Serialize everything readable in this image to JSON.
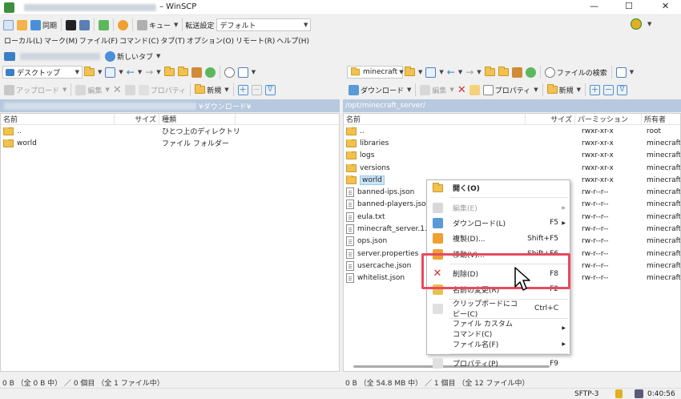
{
  "window": {
    "title": "– WinSCP",
    "minimize": "—",
    "maximize": "☐",
    "close": "✕"
  },
  "toolbar1": {
    "sync_label": "同期",
    "queue_label": "キュー",
    "transfer_settings_label": "転送設定",
    "transfer_preset": "デフォルト"
  },
  "menubar": [
    "ローカル(L)",
    "マーク(M)",
    "ファイル(F)",
    "コマンド(C)",
    "タブ(T)",
    "オプション(O)",
    "リモート(R)",
    "ヘルプ(H)"
  ],
  "sessionbar": {
    "new_tab_label": "新しいタブ"
  },
  "left": {
    "drive_label": "デスクトップ",
    "upload_label": "アップロード",
    "edit_label": "編集",
    "properties_label": "プロパティ",
    "new_label": "新規",
    "path": "¥ダウンロード¥",
    "columns": {
      "name": "名前",
      "size": "サイズ",
      "type": "種類"
    },
    "files": [
      {
        "name": "..",
        "size": "",
        "type": "ひとつ上のディレクトリ",
        "icon": "up-folder"
      },
      {
        "name": "world",
        "size": "",
        "type": "ファイル フォルダー",
        "icon": "folder"
      }
    ],
    "status": "0 B （全 0 B 中） ／ 0 個目 （全 1 ファイル中）"
  },
  "right": {
    "drive_label": "minecraft",
    "download_label": "ダウンロード",
    "edit_label": "編集",
    "properties_label": "プロパティ",
    "new_label": "新規",
    "search_label": "ファイルの検索",
    "path": "/opt/minecraft_server/",
    "columns": {
      "name": "名前",
      "size": "サイズ",
      "permissions": "パーミッション",
      "owner": "所有者"
    },
    "files": [
      {
        "name": "..",
        "perm": "rwxr-xr-x",
        "owner": "root",
        "icon": "up-folder"
      },
      {
        "name": "libraries",
        "perm": "rwxr-xr-x",
        "owner": "minecraft",
        "icon": "folder"
      },
      {
        "name": "logs",
        "perm": "rwxr-xr-x",
        "owner": "minecraft",
        "icon": "folder"
      },
      {
        "name": "versions",
        "perm": "rwxr-xr-x",
        "owner": "minecraft",
        "icon": "folder"
      },
      {
        "name": "world",
        "perm": "rwxr-xr-x",
        "owner": "minecraft",
        "icon": "folder"
      },
      {
        "name": "banned-ips.json",
        "perm": "rw-r--r--",
        "owner": "minecraft",
        "icon": "file"
      },
      {
        "name": "banned-players.json",
        "perm": "rw-r--r--",
        "owner": "minecraft",
        "icon": "file"
      },
      {
        "name": "eula.txt",
        "perm": "rw-r--r--",
        "owner": "minecraft",
        "icon": "file"
      },
      {
        "name": "minecraft_server.1.21",
        "perm": "rw-r--r--",
        "owner": "minecraft",
        "icon": "file"
      },
      {
        "name": "ops.json",
        "perm": "rw-r--r--",
        "owner": "minecraft",
        "icon": "file"
      },
      {
        "name": "server.properties",
        "perm": "rw-r--r--",
        "owner": "minecraft",
        "icon": "file"
      },
      {
        "name": "usercache.json",
        "perm": "rw-r--r--",
        "owner": "minecraft",
        "icon": "file"
      },
      {
        "name": "whitelist.json",
        "perm": "rw-r--r--",
        "owner": "minecraft",
        "icon": "file"
      }
    ],
    "status": "0 B （全 54.8 MB 中） ／ 1 個目 （全 12 ファイル中）"
  },
  "context_menu": [
    {
      "label": "開く(O)",
      "shortcut": "",
      "bold": true,
      "disabled": false,
      "sub": false
    },
    {
      "label": "編集(E)",
      "shortcut": "",
      "disabled": true,
      "sub": true
    },
    {
      "label": "ダウンロード(L)",
      "shortcut": "F5",
      "disabled": false,
      "sub": true
    },
    {
      "label": "複製(D)...",
      "shortcut": "Shift+F5",
      "disabled": false,
      "sub": false
    },
    {
      "label": "移動(V)...",
      "shortcut": "Shift+F6",
      "disabled": false,
      "sub": false
    },
    {
      "label": "削除(D)",
      "shortcut": "F8",
      "disabled": false,
      "sub": false
    },
    {
      "label": "名前の変更(R)",
      "shortcut": "F2",
      "disabled": false,
      "sub": false
    },
    {
      "label": "クリップボードにコピー(C)",
      "shortcut": "Ctrl+C",
      "disabled": false,
      "sub": false
    },
    {
      "label": "ファイル カスタム コマンド(C)",
      "shortcut": "",
      "disabled": false,
      "sub": true
    },
    {
      "label": "ファイル名(F)",
      "shortcut": "",
      "disabled": false,
      "sub": true
    },
    {
      "label": "プロパティ(P)",
      "shortcut": "F9",
      "disabled": false,
      "sub": false
    }
  ],
  "statusbar": {
    "protocol": "SFTP-3",
    "time": "0:40:56"
  },
  "colors": {
    "highlight": "#e84a5f",
    "path_bar": "#b7c9de",
    "folder": "#f2c14e"
  }
}
